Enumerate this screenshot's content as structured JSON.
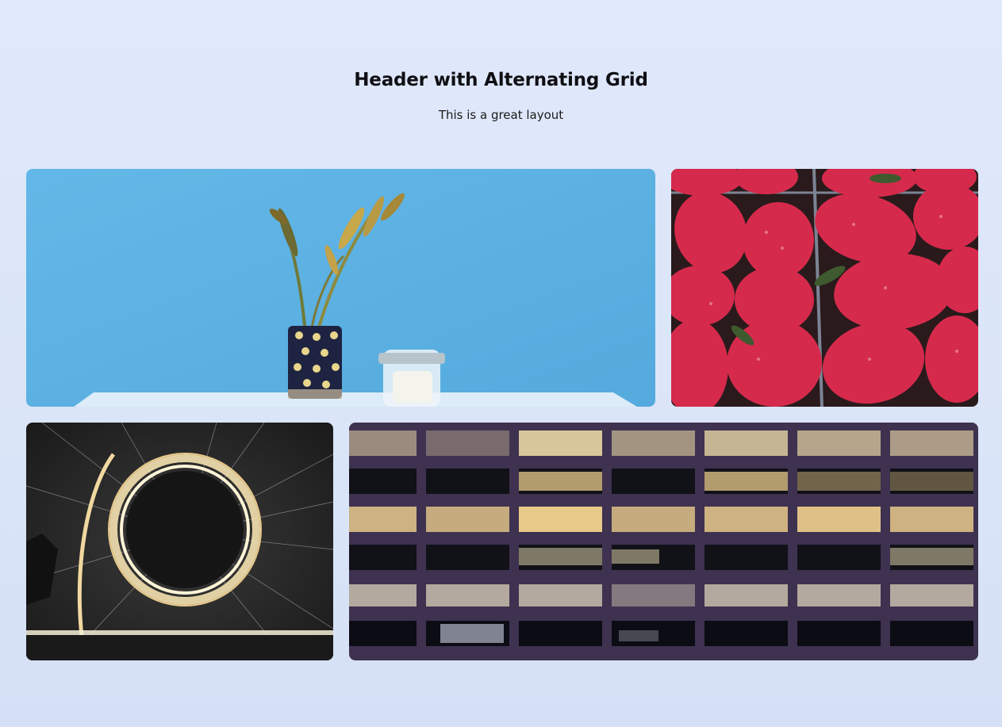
{
  "header": {
    "title": "Header with Alternating Grid",
    "subtitle": "This is a great layout"
  },
  "grid": {
    "tiles": [
      {
        "subject": "plant-in-vase-blue-wall",
        "colors": {
          "wall": "#5cb3e6",
          "table": "#dcecf8"
        }
      },
      {
        "subject": "strawberries",
        "colors": {
          "berry": "#d62a4c",
          "dark": "#2a1a1c"
        }
      },
      {
        "subject": "steel-wool-light-circle",
        "colors": {
          "glow": "#f5e2b0",
          "dark": "#1c1c1c"
        }
      },
      {
        "subject": "office-building-at-night",
        "colors": {
          "frame": "#3e3250",
          "window": "#e8d6a4"
        }
      }
    ]
  }
}
